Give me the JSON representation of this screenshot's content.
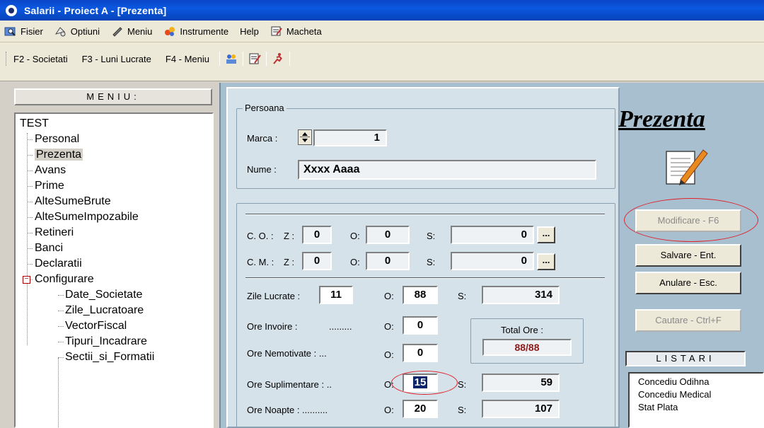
{
  "window": {
    "title": "Salarii - Proiect A  - [Prezenta]"
  },
  "menubar": {
    "items": [
      {
        "label": "Fisier",
        "icon": "folder-search-icon"
      },
      {
        "label": "Optiuni",
        "icon": "options-icon"
      },
      {
        "label": "Meniu",
        "icon": "pencil-icon"
      },
      {
        "label": "Instrumente",
        "icon": "tools-icon"
      },
      {
        "label": "Help",
        "icon": ""
      },
      {
        "label": "Macheta",
        "icon": "form-icon"
      }
    ]
  },
  "toolbar": {
    "items": [
      "F2 - Societati",
      "F3 - Luni Lucrate",
      "F4 - Meniu"
    ]
  },
  "sidebar": {
    "header": "MENIU:",
    "root": "TEST",
    "items": [
      "Personal",
      "Prezenta",
      "Avans",
      "Prime",
      "AlteSumeBrute",
      "AlteSumeImpozabile",
      "Retineri",
      "Banci",
      "Declaratii"
    ],
    "folder": "Configurare",
    "children": [
      "Date_Societate",
      "Zile_Lucratoare",
      "VectorFiscal",
      "Tipuri_Incadrare",
      "Sectii_si_Formatii"
    ],
    "selected": "Prezenta"
  },
  "persoana": {
    "legend": "Persoana",
    "marca_label": "Marca :",
    "marca_value": "1",
    "nume_label": "Nume :",
    "nume_value": "Xxxx Aaaa"
  },
  "form": {
    "co_label": "C. O. :",
    "cm_label": "C. M. :",
    "z_label": "Z :",
    "o_label": "O:",
    "s_label": "S:",
    "co": {
      "z": "0",
      "o": "0",
      "s": "0"
    },
    "cm": {
      "z": "0",
      "o": "0",
      "s": "0"
    },
    "zile_lucrate_label": "Zile Lucrate :",
    "zile_lucrate": "11",
    "zile_o": "88",
    "zile_s": "314",
    "ore_invoire_label": "Ore Invoire :",
    "ore_invoire_dots": ".........",
    "ore_invoire_o": "0",
    "ore_nemotivate_label": "Ore Nemotivate : ...",
    "ore_nemotivate_o": "0",
    "ore_suplimentare_label": "Ore Suplimentare : ..",
    "ore_suplimentare_o": "15",
    "ore_suplimentare_s": "59",
    "ore_noapte_label": "Ore Noapte : ..........",
    "ore_noapte_o": "20",
    "ore_noapte_s": "107",
    "total_label": "Total Ore :",
    "total_value": "88/88",
    "dots_button": "..."
  },
  "right": {
    "title": "Prezenta",
    "modificare": "Modificare - F6",
    "salvare": "Salvare    - Ent.",
    "anulare": "Anulare   - Esc.",
    "cautare": "Cautare - Ctrl+F",
    "listari_header": "LISTARI",
    "listari": [
      "Concediu Odihna",
      "Concediu Medical",
      "Stat Plata"
    ]
  },
  "colors": {
    "titlebar": "#0a58e0",
    "highlight": "#e0202a",
    "total": "#8b1a1a"
  }
}
